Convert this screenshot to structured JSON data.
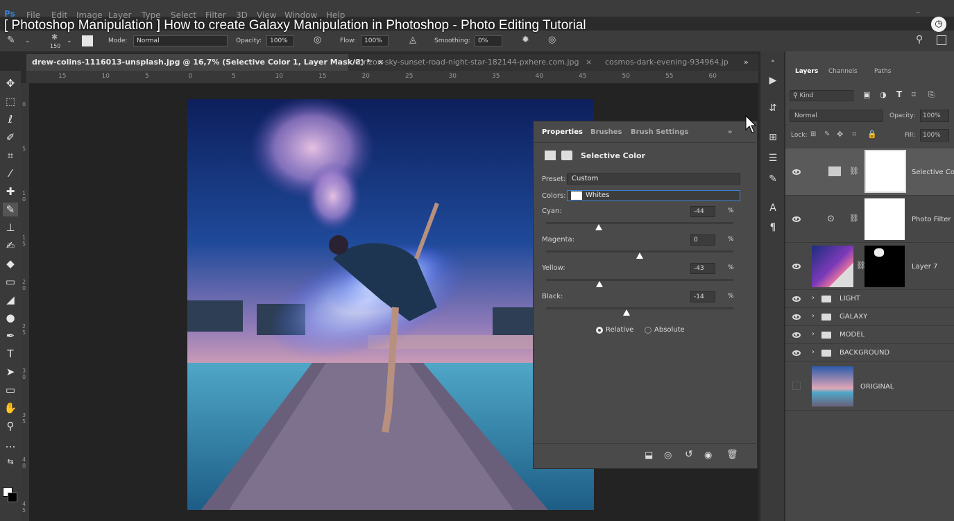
{
  "menu": [
    "File",
    "Edit",
    "Image",
    "Layer",
    "Type",
    "Select",
    "Filter",
    "3D",
    "View",
    "Window",
    "Help"
  ],
  "video_title": "[ Photoshop Manipulation ] How to create Galaxy Manipulation in Photoshop - Photo Editing Tutorial",
  "options_bar": {
    "brush_size": "150",
    "mode_label": "Mode:",
    "mode_value": "Normal",
    "opacity_label": "Opacity:",
    "opacity_value": "100%",
    "flow_label": "Flow:",
    "flow_value": "100%",
    "smoothing_label": "Smoothing:",
    "smoothing_value": "0%"
  },
  "tabs": [
    {
      "label": "drew-colins-1116013-unsplash.jpg @ 16,7% (Selective Color 1, Layer Mask/8) *",
      "close": "×",
      "active": true
    },
    {
      "label": "horizon-sky-sunset-road-night-star-182144-pxhere.com.jpg",
      "close": "×",
      "active": false
    },
    {
      "label": "cosmos-dark-evening-934964.jp",
      "close": "",
      "active": false
    }
  ],
  "tabs_overflow": "»",
  "ruler_top_ticks": [
    "15",
    "10",
    "5",
    "0",
    "5",
    "10",
    "15",
    "20",
    "25",
    "30",
    "35",
    "40",
    "45",
    "50",
    "55",
    "60"
  ],
  "ruler_left_ticks": [
    "0",
    "5",
    "1 0",
    "1 5",
    "2 0",
    "2 5",
    "3 0",
    "3 5",
    "4 0",
    "4 5"
  ],
  "properties": {
    "tabs": [
      "Properties",
      "Brushes",
      "Brush Settings"
    ],
    "menu": "»",
    "title": "Selective Color",
    "preset_label": "Preset:",
    "preset_value": "Custom",
    "colors_label": "Colors:",
    "colors_value": "Whites",
    "sliders": [
      {
        "label": "Cyan:",
        "value": "-44",
        "pos": 0.28
      },
      {
        "label": "Magenta:",
        "value": "0",
        "pos": 0.5
      },
      {
        "label": "Yellow:",
        "value": "-43",
        "pos": 0.285
      },
      {
        "label": "Black:",
        "value": "-14",
        "pos": 0.43
      }
    ],
    "pct": "%",
    "method_relative": "Relative",
    "method_absolute": "Absolute"
  },
  "layers_panel": {
    "tabs": [
      "Layers",
      "Channels",
      "Paths"
    ],
    "kind_label": "Kind",
    "blend_mode": "Normal",
    "opacity_label": "Opacity:",
    "opacity_value": "100%",
    "lock_label": "Lock:",
    "fill_label": "Fill:",
    "fill_value": "100%",
    "layers": [
      {
        "name": "Selective Co",
        "type": "adjustment"
      },
      {
        "name": "Photo Filter",
        "type": "adjustment"
      },
      {
        "name": "Layer 7",
        "type": "pixel"
      },
      {
        "name": "LIGHT",
        "type": "group"
      },
      {
        "name": "GALAXY",
        "type": "group"
      },
      {
        "name": "MODEL",
        "type": "group"
      },
      {
        "name": "BACKGROUND",
        "type": "group"
      },
      {
        "name": "ORIGINAL",
        "type": "pixel"
      }
    ]
  },
  "colors": {
    "accent": "#3c86d8",
    "panel": "#4a4a4a",
    "canvas": "#232323"
  }
}
